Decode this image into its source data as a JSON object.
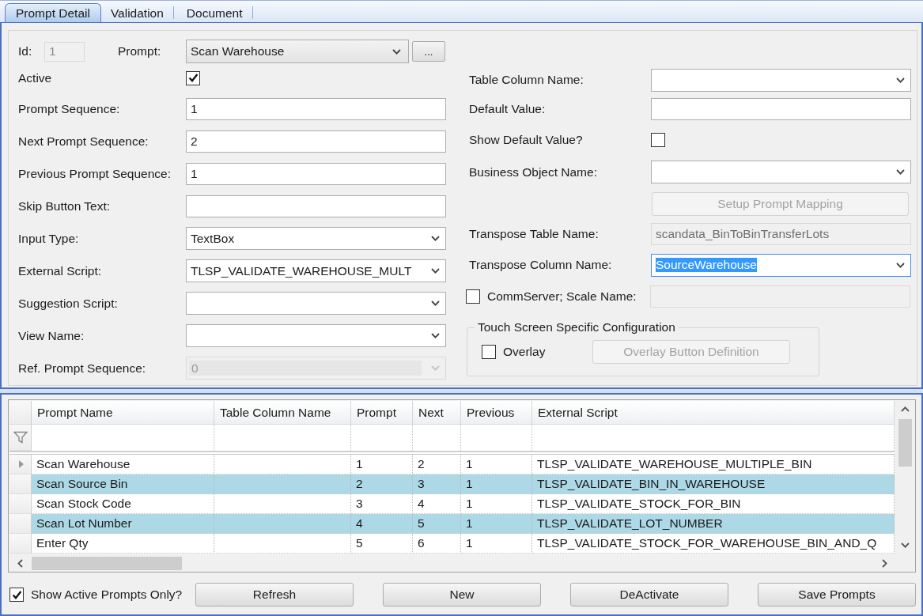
{
  "tabs": [
    {
      "label": "Prompt Detail",
      "selected": true
    },
    {
      "label": "Validation",
      "selected": false
    },
    {
      "label": "Document",
      "selected": false
    }
  ],
  "detail": {
    "id": {
      "label": "Id:",
      "value": "1",
      "disabled": true
    },
    "prompt": {
      "label": "Prompt:",
      "value": "Scan Warehouse",
      "browse_button": "..."
    },
    "left_fields": [
      {
        "kind": "checkbox",
        "label": "Active",
        "checked": true,
        "disabled": false
      },
      {
        "kind": "text",
        "label": "Prompt Sequence:",
        "value": "1",
        "disabled": false,
        "focused": false
      },
      {
        "kind": "text",
        "label": "Next Prompt Sequence:",
        "value": "2",
        "disabled": false,
        "focused": false
      },
      {
        "kind": "text",
        "label": "Previous Prompt Sequence:",
        "value": "1",
        "disabled": false,
        "focused": false
      },
      {
        "kind": "text",
        "label": "Skip Button Text:",
        "disabled": false,
        "focused": false
      },
      {
        "kind": "combo",
        "label": "Input Type:",
        "value": "TextBox",
        "disabled": false,
        "focused": false
      },
      {
        "kind": "combo",
        "label": "External Script:",
        "value": "TLSP_VALIDATE_WAREHOUSE_MULT",
        "disabled": false,
        "focused": false
      },
      {
        "kind": "combo",
        "label": "Suggestion Script:",
        "disabled": false,
        "focused": false
      },
      {
        "kind": "combo",
        "label": "View Name:",
        "disabled": false,
        "focused": false
      },
      {
        "kind": "combo",
        "label": "Ref. Prompt Sequence:",
        "value": "0",
        "disabled": true,
        "focused": false
      }
    ],
    "right_fields": [
      {
        "kind": "combo",
        "label": "Table Column Name:",
        "disabled": false,
        "focused": false
      },
      {
        "kind": "text",
        "label": "Default Value:",
        "disabled": false,
        "focused": false
      },
      {
        "kind": "checkbox",
        "label": "Show Default Value?",
        "checked": false,
        "disabled": false
      },
      {
        "kind": "combo",
        "label": "Business Object Name:",
        "disabled": false,
        "focused": false
      },
      {
        "kind": "button",
        "label": "Setup Prompt Mapping",
        "disabled": true
      },
      {
        "kind": "text",
        "label": "Transpose Table Name:",
        "value": "scandata_BinToBinTransferLots",
        "disabled": true,
        "focused": false
      },
      {
        "kind": "combo",
        "label": "Transpose Column Name:",
        "value": "SourceWarehouse",
        "disabled": false,
        "focused": true
      },
      {
        "kind": "check_field",
        "label": "CommServer; Scale Name:",
        "checked": false,
        "disabled": true
      }
    ],
    "touch_group": {
      "title": "Touch Screen Specific Configuration",
      "overlay": {
        "label": "Overlay",
        "checked": false
      },
      "button": {
        "label": "Overlay Button Definition",
        "disabled": true
      }
    }
  },
  "grid": {
    "columns": [
      "Prompt Name",
      "Table Column Name",
      "Prompt",
      "Next",
      "Previous",
      "External Script"
    ],
    "rows": [
      {
        "selected": true,
        "prompt_name": "Scan Warehouse",
        "prompt": "1",
        "next": "2",
        "previous": "1",
        "external_script": "TLSP_VALIDATE_WAREHOUSE_MULTIPLE_BIN"
      },
      {
        "selected": false,
        "prompt_name": "Scan Source Bin",
        "prompt": "2",
        "next": "3",
        "previous": "1",
        "external_script": "TLSP_VALIDATE_BIN_IN_WAREHOUSE"
      },
      {
        "selected": false,
        "prompt_name": "Scan Stock Code",
        "prompt": "3",
        "next": "4",
        "previous": "1",
        "external_script": "TLSP_VALIDATE_STOCK_FOR_BIN"
      },
      {
        "selected": false,
        "prompt_name": "Scan Lot Number",
        "prompt": "4",
        "next": "5",
        "previous": "1",
        "external_script": "TLSP_VALIDATE_LOT_NUMBER"
      },
      {
        "selected": false,
        "prompt_name": "Enter Qty",
        "prompt": "5",
        "next": "6",
        "previous": "1",
        "external_script": "TLSP_VALIDATE_STOCK_FOR_WAREHOUSE_BIN_AND_Q"
      }
    ]
  },
  "footer": {
    "show_active": {
      "label": "Show Active Prompts Only?",
      "checked": true
    },
    "buttons": [
      "Refresh",
      "New",
      "DeActivate",
      "Save Prompts"
    ]
  }
}
